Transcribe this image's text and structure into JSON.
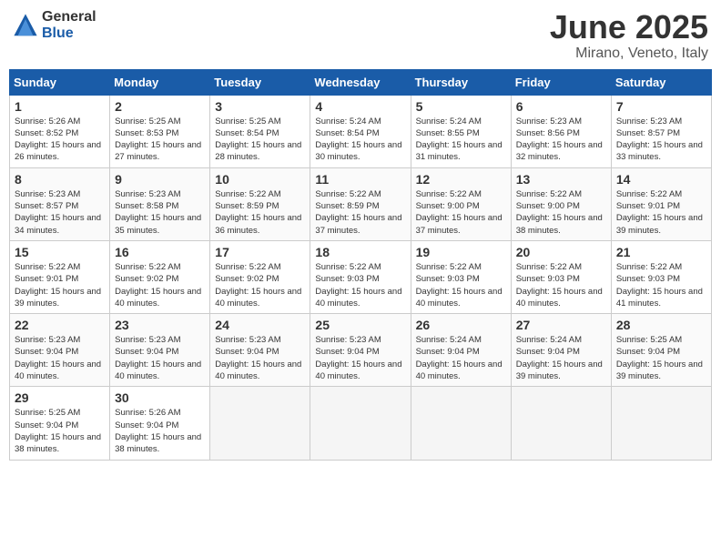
{
  "logo": {
    "general": "General",
    "blue": "Blue"
  },
  "title": "June 2025",
  "subtitle": "Mirano, Veneto, Italy",
  "weekdays": [
    "Sunday",
    "Monday",
    "Tuesday",
    "Wednesday",
    "Thursday",
    "Friday",
    "Saturday"
  ],
  "weeks": [
    [
      {
        "day": "1",
        "rise": "Sunrise: 5:26 AM",
        "set": "Sunset: 8:52 PM",
        "daylight": "Daylight: 15 hours and 26 minutes."
      },
      {
        "day": "2",
        "rise": "Sunrise: 5:25 AM",
        "set": "Sunset: 8:53 PM",
        "daylight": "Daylight: 15 hours and 27 minutes."
      },
      {
        "day": "3",
        "rise": "Sunrise: 5:25 AM",
        "set": "Sunset: 8:54 PM",
        "daylight": "Daylight: 15 hours and 28 minutes."
      },
      {
        "day": "4",
        "rise": "Sunrise: 5:24 AM",
        "set": "Sunset: 8:54 PM",
        "daylight": "Daylight: 15 hours and 30 minutes."
      },
      {
        "day": "5",
        "rise": "Sunrise: 5:24 AM",
        "set": "Sunset: 8:55 PM",
        "daylight": "Daylight: 15 hours and 31 minutes."
      },
      {
        "day": "6",
        "rise": "Sunrise: 5:23 AM",
        "set": "Sunset: 8:56 PM",
        "daylight": "Daylight: 15 hours and 32 minutes."
      },
      {
        "day": "7",
        "rise": "Sunrise: 5:23 AM",
        "set": "Sunset: 8:57 PM",
        "daylight": "Daylight: 15 hours and 33 minutes."
      }
    ],
    [
      {
        "day": "8",
        "rise": "Sunrise: 5:23 AM",
        "set": "Sunset: 8:57 PM",
        "daylight": "Daylight: 15 hours and 34 minutes."
      },
      {
        "day": "9",
        "rise": "Sunrise: 5:23 AM",
        "set": "Sunset: 8:58 PM",
        "daylight": "Daylight: 15 hours and 35 minutes."
      },
      {
        "day": "10",
        "rise": "Sunrise: 5:22 AM",
        "set": "Sunset: 8:59 PM",
        "daylight": "Daylight: 15 hours and 36 minutes."
      },
      {
        "day": "11",
        "rise": "Sunrise: 5:22 AM",
        "set": "Sunset: 8:59 PM",
        "daylight": "Daylight: 15 hours and 37 minutes."
      },
      {
        "day": "12",
        "rise": "Sunrise: 5:22 AM",
        "set": "Sunset: 9:00 PM",
        "daylight": "Daylight: 15 hours and 37 minutes."
      },
      {
        "day": "13",
        "rise": "Sunrise: 5:22 AM",
        "set": "Sunset: 9:00 PM",
        "daylight": "Daylight: 15 hours and 38 minutes."
      },
      {
        "day": "14",
        "rise": "Sunrise: 5:22 AM",
        "set": "Sunset: 9:01 PM",
        "daylight": "Daylight: 15 hours and 39 minutes."
      }
    ],
    [
      {
        "day": "15",
        "rise": "Sunrise: 5:22 AM",
        "set": "Sunset: 9:01 PM",
        "daylight": "Daylight: 15 hours and 39 minutes."
      },
      {
        "day": "16",
        "rise": "Sunrise: 5:22 AM",
        "set": "Sunset: 9:02 PM",
        "daylight": "Daylight: 15 hours and 40 minutes."
      },
      {
        "day": "17",
        "rise": "Sunrise: 5:22 AM",
        "set": "Sunset: 9:02 PM",
        "daylight": "Daylight: 15 hours and 40 minutes."
      },
      {
        "day": "18",
        "rise": "Sunrise: 5:22 AM",
        "set": "Sunset: 9:03 PM",
        "daylight": "Daylight: 15 hours and 40 minutes."
      },
      {
        "day": "19",
        "rise": "Sunrise: 5:22 AM",
        "set": "Sunset: 9:03 PM",
        "daylight": "Daylight: 15 hours and 40 minutes."
      },
      {
        "day": "20",
        "rise": "Sunrise: 5:22 AM",
        "set": "Sunset: 9:03 PM",
        "daylight": "Daylight: 15 hours and 40 minutes."
      },
      {
        "day": "21",
        "rise": "Sunrise: 5:22 AM",
        "set": "Sunset: 9:03 PM",
        "daylight": "Daylight: 15 hours and 41 minutes."
      }
    ],
    [
      {
        "day": "22",
        "rise": "Sunrise: 5:23 AM",
        "set": "Sunset: 9:04 PM",
        "daylight": "Daylight: 15 hours and 40 minutes."
      },
      {
        "day": "23",
        "rise": "Sunrise: 5:23 AM",
        "set": "Sunset: 9:04 PM",
        "daylight": "Daylight: 15 hours and 40 minutes."
      },
      {
        "day": "24",
        "rise": "Sunrise: 5:23 AM",
        "set": "Sunset: 9:04 PM",
        "daylight": "Daylight: 15 hours and 40 minutes."
      },
      {
        "day": "25",
        "rise": "Sunrise: 5:23 AM",
        "set": "Sunset: 9:04 PM",
        "daylight": "Daylight: 15 hours and 40 minutes."
      },
      {
        "day": "26",
        "rise": "Sunrise: 5:24 AM",
        "set": "Sunset: 9:04 PM",
        "daylight": "Daylight: 15 hours and 40 minutes."
      },
      {
        "day": "27",
        "rise": "Sunrise: 5:24 AM",
        "set": "Sunset: 9:04 PM",
        "daylight": "Daylight: 15 hours and 39 minutes."
      },
      {
        "day": "28",
        "rise": "Sunrise: 5:25 AM",
        "set": "Sunset: 9:04 PM",
        "daylight": "Daylight: 15 hours and 39 minutes."
      }
    ],
    [
      {
        "day": "29",
        "rise": "Sunrise: 5:25 AM",
        "set": "Sunset: 9:04 PM",
        "daylight": "Daylight: 15 hours and 38 minutes."
      },
      {
        "day": "30",
        "rise": "Sunrise: 5:26 AM",
        "set": "Sunset: 9:04 PM",
        "daylight": "Daylight: 15 hours and 38 minutes."
      },
      null,
      null,
      null,
      null,
      null
    ]
  ]
}
